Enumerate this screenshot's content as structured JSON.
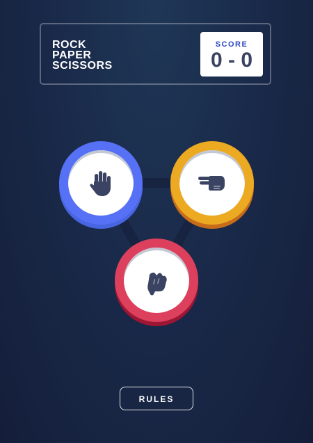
{
  "header": {
    "title_lines": [
      "ROCK",
      "PAPER",
      "SCISSORS"
    ],
    "score_label": "SCORE",
    "score_value": "0 - 0"
  },
  "tokens": [
    {
      "name": "paper",
      "color": "#5671f5",
      "icon": "paper-hand-icon"
    },
    {
      "name": "scissors",
      "color": "#eca922",
      "icon": "scissors-hand-icon"
    },
    {
      "name": "rock",
      "color": "#dd405d",
      "icon": "rock-fist-icon"
    }
  ],
  "rules": {
    "label": "RULES"
  },
  "colors": {
    "background": "#1a2a4a",
    "score_label": "#2a46c0",
    "score_value": "#3b4363",
    "icon": "#3b4363"
  }
}
